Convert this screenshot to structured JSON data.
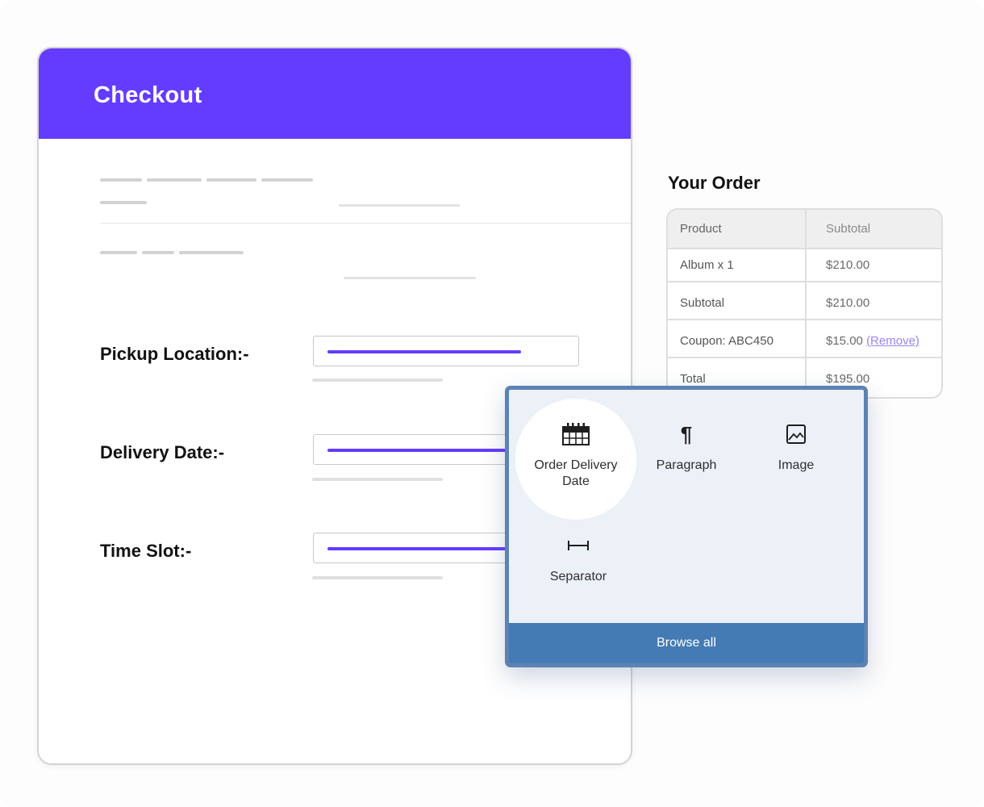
{
  "checkout": {
    "title": "Checkout",
    "header_color": "#643cff",
    "fields": [
      {
        "label": "Pickup Location:-"
      },
      {
        "label": "Delivery Date:-"
      },
      {
        "label": "Time Slot:-"
      }
    ]
  },
  "order": {
    "title": "Your Order",
    "columns": [
      "Product",
      "Subtotal"
    ],
    "rows": [
      {
        "label": "Album x 1",
        "value": "$210.00"
      },
      {
        "label": "Subtotal",
        "value": "$210.00"
      },
      {
        "label": "Coupon: ABC450",
        "value": "$15.00",
        "link": "(Remove)"
      },
      {
        "label": "Total",
        "value": "$195.00"
      }
    ]
  },
  "inserter": {
    "blocks": [
      {
        "label": "Order Delivery Date",
        "icon": "calendar-icon"
      },
      {
        "label": "Paragraph",
        "icon": "pilcrow-icon"
      },
      {
        "label": "Image",
        "icon": "image-icon"
      },
      {
        "label": "Separator",
        "icon": "separator-icon"
      }
    ],
    "browse_all": "Browse all",
    "accent": "#447bb4"
  }
}
